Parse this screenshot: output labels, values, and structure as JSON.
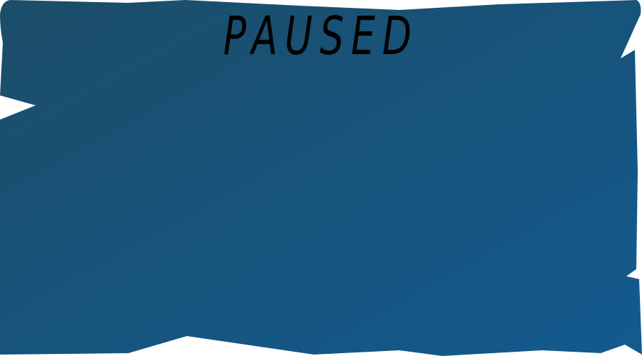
{
  "pause_menu": {
    "title": "PAUSED",
    "panel_style": "torn-paper",
    "panel_color_start": "#1b4d68",
    "panel_color_end": "#135a8f",
    "title_color": "#000000"
  }
}
